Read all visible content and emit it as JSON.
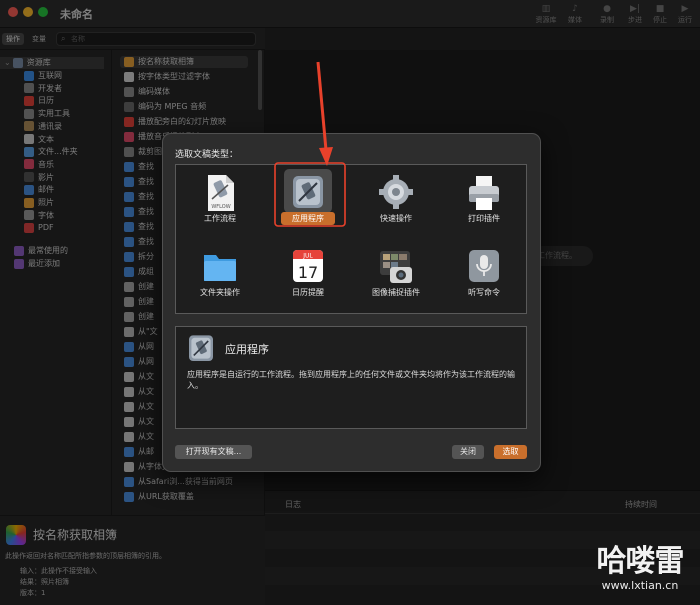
{
  "window": {
    "title": "未命名"
  },
  "toolbar": {
    "items": [
      "资源库",
      "媒体",
      "录制",
      "步进",
      "停止",
      "运行"
    ]
  },
  "sidebar": {
    "tabs": [
      "操作",
      "变量"
    ],
    "search_placeholder": "名称",
    "library_root": "资源库",
    "categories": [
      "互联网",
      "开发者",
      "日历",
      "实用工具",
      "通讯录",
      "文本",
      "文件...件夹",
      "音乐",
      "影片",
      "邮件",
      "照片",
      "字体",
      "PDF"
    ],
    "extra": [
      "最常使用的",
      "最近添加"
    ]
  },
  "actions": {
    "items": [
      "按名称获取相簿",
      "按字体类型过滤字体",
      "编码媒体",
      "编码为 MPEG 音频",
      "播放配旁白的幻灯片放映",
      "播放音乐播放列表",
      "裁剪图",
      "查找",
      "查找",
      "查找",
      "查找",
      "查找",
      "查找",
      "拆分",
      "成组",
      "创建",
      "创建",
      "创建",
      "从\"文",
      "从网",
      "从网",
      "从文",
      "从文",
      "从文",
      "从文",
      "从文",
      "从邮",
      "从字体文件获得字体",
      "从Safari浏...获得当前网页",
      "从URL获取覆盖"
    ]
  },
  "description": {
    "title": "按名称获取相簿",
    "text": "此操作返回对名称匹配所指参数的顶层相簿的引用。",
    "input": "输入：此操作不接受输入",
    "result": "结果：照片相簿",
    "version": "版本：1"
  },
  "workflow": {
    "placeholder": "工作流程。"
  },
  "log": {
    "col1": "日志",
    "col2": "持续时间"
  },
  "dialog": {
    "heading": "选取文稿类型：",
    "types": [
      {
        "label": "工作流程",
        "icon": "workflow-icon"
      },
      {
        "label": "应用程序",
        "icon": "application-icon",
        "selected": true
      },
      {
        "label": "快速操作",
        "icon": "gear-icon"
      },
      {
        "label": "打印插件",
        "icon": "printer-icon"
      },
      {
        "label": "文件夹操作",
        "icon": "folder-icon"
      },
      {
        "label": "日历提醒",
        "icon": "calendar-icon",
        "month": "JUL",
        "day": "17"
      },
      {
        "label": "图像捕捉插件",
        "icon": "image-capture-icon"
      },
      {
        "label": "听写命令",
        "icon": "microphone-icon"
      }
    ],
    "workflow_badge": "WFLOW",
    "info_title": "应用程序",
    "info_text": "应用程序是自运行的工作流程。拖到应用程序上的任何文件或文件夹均将作为该工作流程的输入。",
    "open_existing": "打开现有文稿...",
    "close": "关闭",
    "choose": "选取"
  },
  "watermark": {
    "brand": "哈喽雷",
    "url": "www.lxtian.cn"
  },
  "colors": {
    "accent": "#c96f2c",
    "arrow": "#e8412b",
    "background": "#232323"
  }
}
